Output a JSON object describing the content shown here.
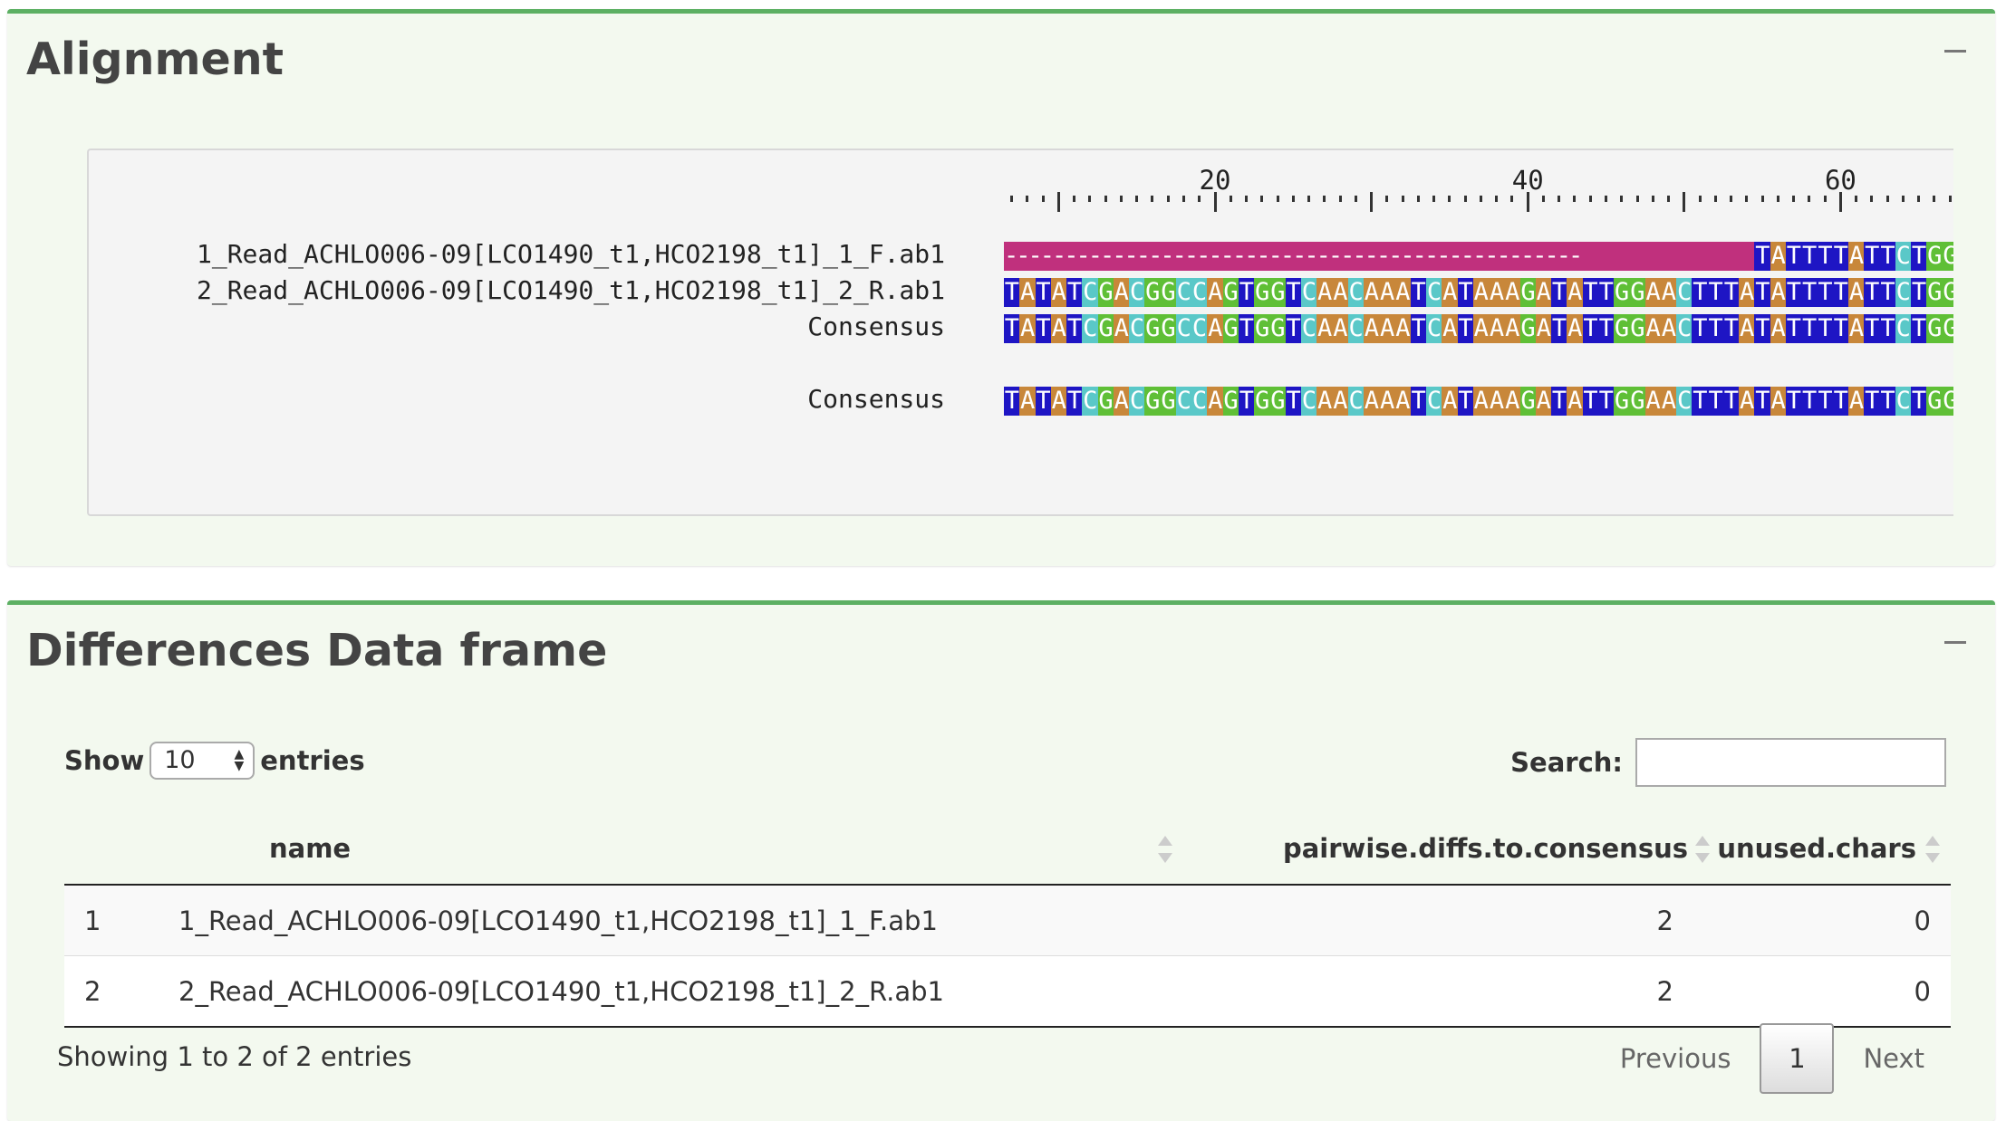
{
  "alignment_box": {
    "title": "Alignment",
    "ruler_labels": [
      "20",
      "40",
      "60"
    ],
    "rows": [
      {
        "name": "1_Read_ACHLO006-09[LCO1490_t1,HCO2198_t1]_1_F.ab1",
        "gap_text": "------------------------------------------------",
        "seq": "TATTTTATTCTGG"
      },
      {
        "name": "2_Read_ACHLO006-09[LCO1490_t1,HCO2198_t1]_2_R.ab1",
        "seq": "TATATCGACGGCCAGTGGTCAACAAATCATAAAGATATTGGAACTTTATATTTTATTCTGG"
      },
      {
        "name": "Consensus",
        "seq": "TATATCGACGGCCAGTGGTCAACAAATCATAAAGATATTGGAACTTTATATTTTATTCTGG"
      },
      {
        "name": "Consensus",
        "seq": "TATATCGACGGCCAGTGGTCAACAAATCATAAAGATATTGGAACTTTATATTTTATTCTGG"
      }
    ],
    "base_colors": {
      "A": "#c8873a",
      "T": "#1e15c4",
      "C": "#5ac8c8",
      "G": "#5fbf36",
      "gap": "#c0307d"
    }
  },
  "diff_box": {
    "title": "Differences Data frame",
    "length_prefix": "Show",
    "length_value": "10",
    "length_suffix": "entries",
    "search_label": "Search:",
    "search_value": "",
    "columns": [
      "",
      "name",
      "pairwise.diffs.to.consensus",
      "unused.chars"
    ],
    "rows": [
      [
        "1",
        "1_Read_ACHLO006-09[LCO1490_t1,HCO2198_t1]_1_F.ab1",
        "2",
        "0"
      ],
      [
        "2",
        "2_Read_ACHLO006-09[LCO1490_t1,HCO2198_t1]_2_R.ab1",
        "2",
        "0"
      ]
    ],
    "info": "Showing 1 to 2 of 2 entries",
    "pager": {
      "previous": "Previous",
      "current": "1",
      "next": "Next"
    }
  }
}
